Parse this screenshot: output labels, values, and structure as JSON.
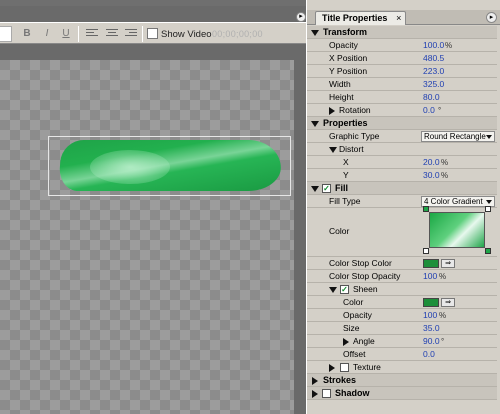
{
  "toolbar": {
    "bold_label": "B",
    "italic_label": "I",
    "underline_label": "U",
    "show_video_label": "Show Video",
    "timecode": "00;00;00;00"
  },
  "panel": {
    "tab_title": "Title Properties",
    "close_glyph": "×",
    "menu_glyph": "▸"
  },
  "transform": {
    "header": "Transform",
    "rows": [
      {
        "label": "Opacity",
        "value": "100.0",
        "unit": "%"
      },
      {
        "label": "X Position",
        "value": "480.5",
        "unit": ""
      },
      {
        "label": "Y Position",
        "value": "223.0",
        "unit": ""
      },
      {
        "label": "Width",
        "value": "325.0",
        "unit": ""
      },
      {
        "label": "Height",
        "value": "80.0",
        "unit": ""
      },
      {
        "label": "Rotation",
        "value": "0.0",
        "unit": "°"
      }
    ]
  },
  "properties": {
    "header": "Properties",
    "graphic_type_label": "Graphic Type",
    "graphic_type_value": "Round Rectangle",
    "distort_label": "Distort",
    "distort_x_label": "X",
    "distort_x_value": "20.0",
    "distort_y_label": "Y",
    "distort_y_value": "30.0",
    "unit_percent": "%"
  },
  "fill": {
    "header": "Fill",
    "fill_type_label": "Fill Type",
    "fill_type_value": "4 Color Gradient",
    "color_label": "Color",
    "color_stop_color_label": "Color Stop Color",
    "color_stop_opacity_label": "Color Stop Opacity",
    "color_stop_opacity_value": "100",
    "sheen_label": "Sheen",
    "sheen_color_label": "Color",
    "sheen_opacity_label": "Opacity",
    "sheen_opacity_value": "100",
    "sheen_size_label": "Size",
    "sheen_size_value": "35.0",
    "sheen_angle_label": "Angle",
    "sheen_angle_value": "90.0",
    "sheen_offset_label": "Offset",
    "sheen_offset_value": "0.0",
    "texture_label": "Texture",
    "degree": "°"
  },
  "strokes": {
    "header": "Strokes"
  },
  "shadow": {
    "header": "Shadow"
  },
  "colors": {
    "fill_green": "#1fa548",
    "value_blue": "#1f3fb2",
    "panel_bg": "#d4d0c8"
  }
}
